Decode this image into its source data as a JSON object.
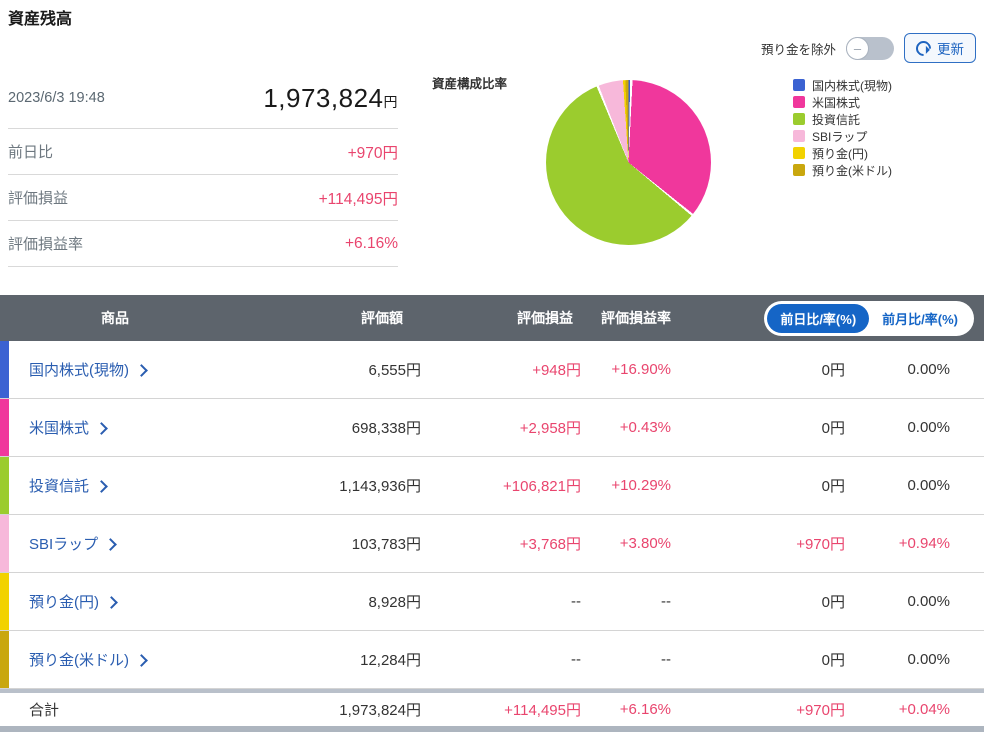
{
  "page": {
    "title": "資産残高"
  },
  "controls": {
    "toggle_label": "預り金を除外",
    "toggle_state": "off",
    "refresh_label": "更新"
  },
  "summary": {
    "datetime": "2023/6/3 19:48",
    "total_value": "1,973,824",
    "total_unit": "円",
    "rows": [
      {
        "label": "前日比",
        "value": "+970円"
      },
      {
        "label": "評価損益",
        "value": "+114,495円"
      },
      {
        "label": "評価損益率",
        "value": "+6.16%"
      }
    ]
  },
  "chart_data": {
    "type": "pie",
    "title": "資産構成比率",
    "legend_position": "right",
    "slices": [
      {
        "label": "国内株式(現物)",
        "color": "#3b62d2",
        "pct": 0.33,
        "value_yen": 6555
      },
      {
        "label": "米国株式",
        "color": "#f0379c",
        "pct": 35.38,
        "value_yen": 698338
      },
      {
        "label": "投資信託",
        "color": "#9bcc2e",
        "pct": 57.96,
        "value_yen": 1143936
      },
      {
        "label": "SBIラップ",
        "color": "#f7b8da",
        "pct": 5.26,
        "value_yen": 103783
      },
      {
        "label": "預り金(円)",
        "color": "#f2d200",
        "pct": 0.45,
        "value_yen": 8928
      },
      {
        "label": "預り金(米ドル)",
        "color": "#c9a70e",
        "pct": 0.62,
        "value_yen": 12284
      }
    ]
  },
  "table": {
    "headers": {
      "product": "商品",
      "value": "評価額",
      "pl": "評価損益",
      "pl_rate": "評価損益率"
    },
    "toggle": {
      "active": "前日比/率(%)",
      "inactive": "前月比/率(%)"
    },
    "rows": [
      {
        "name": "国内株式(現物)",
        "color": "#3b62d2",
        "value": "6,555円",
        "pl": "+948円",
        "rate": "+16.90%",
        "day": "0円",
        "day_rate": "0.00%"
      },
      {
        "name": "米国株式",
        "color": "#f0379c",
        "value": "698,338円",
        "pl": "+2,958円",
        "rate": "+0.43%",
        "day": "0円",
        "day_rate": "0.00%"
      },
      {
        "name": "投資信託",
        "color": "#9bcc2e",
        "value": "1,143,936円",
        "pl": "+106,821円",
        "rate": "+10.29%",
        "day": "0円",
        "day_rate": "0.00%"
      },
      {
        "name": "SBIラップ",
        "color": "#f7b8da",
        "value": "103,783円",
        "pl": "+3,768円",
        "rate": "+3.80%",
        "day": "+970円",
        "day_rate": "+0.94%"
      },
      {
        "name": "預り金(円)",
        "color": "#f2d200",
        "value": "8,928円",
        "pl": "--",
        "rate": "--",
        "day": "0円",
        "day_rate": "0.00%"
      },
      {
        "name": "預り金(米ドル)",
        "color": "#c9a70e",
        "value": "12,284円",
        "pl": "--",
        "rate": "--",
        "day": "0円",
        "day_rate": "0.00%"
      }
    ],
    "total": {
      "name": "合計",
      "value": "1,973,824円",
      "pl": "+114,495円",
      "rate": "+6.16%",
      "day": "+970円",
      "day_rate": "+0.04%"
    }
  },
  "colors": {
    "accent_negative_pink": "#e9456e",
    "link_blue": "#2a5db0",
    "header_gray": "#5d646c",
    "active_pill_blue": "#1565c6",
    "separator_gray": "#b9c0ca"
  }
}
